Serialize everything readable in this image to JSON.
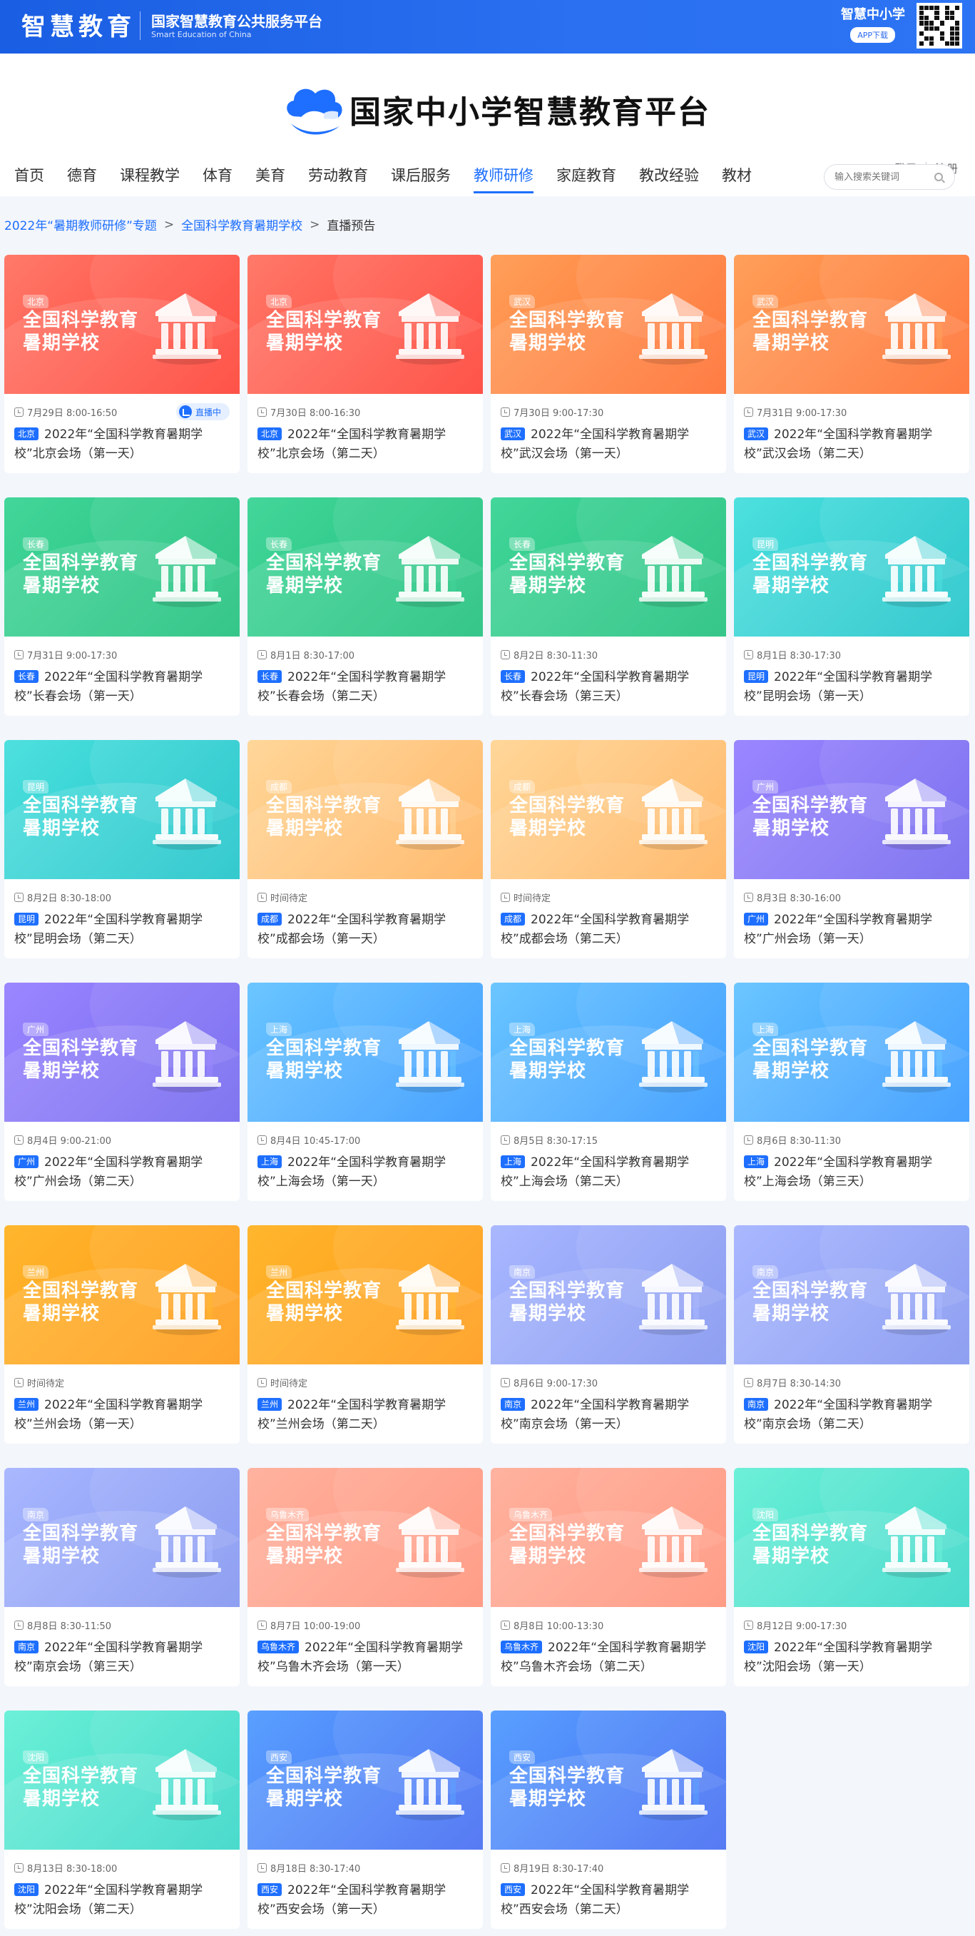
{
  "topbar": {
    "logo": "智慧教育",
    "platform": "国家智慧教育公共服务平台",
    "platform_en": "Smart Education of China",
    "app_title": "智慧中小学",
    "app_button": "APP下载"
  },
  "header": {
    "title": "国家中小学智慧教育平台",
    "login": "登录",
    "register": "注册"
  },
  "nav": [
    "首页",
    "德育",
    "课程教学",
    "体育",
    "美育",
    "劳动教育",
    "课后服务",
    "教师研修",
    "家庭教育",
    "教改经验",
    "教材"
  ],
  "nav_active": "教师研修",
  "search": {
    "placeholder": "输入搜索关键词"
  },
  "breadcrumb": {
    "items": [
      "2022年“暑期教师研修”专题",
      "全国科学教育暑期学校",
      "直播预告"
    ]
  },
  "thumb_title_line1": "全国科学教育",
  "thumb_title_line2": "暑期学校",
  "live_label": "直播中",
  "palettes": {
    "red": [
      "#ff7a6a",
      "#ff3b2f"
    ],
    "orange": [
      "#ffa05a",
      "#ff6a2a"
    ],
    "green": [
      "#44d69a",
      "#1abf7a"
    ],
    "teal": [
      "#4ee0de",
      "#19c2c8"
    ],
    "peach": [
      "#ffd79a",
      "#ffb15a"
    ],
    "purple": [
      "#9b87ff",
      "#6f63ee"
    ],
    "blue": [
      "#6cc6ff",
      "#2e95ff"
    ],
    "amber": [
      "#ffb62e",
      "#ff9812"
    ],
    "periwinkle": [
      "#aab8ff",
      "#7f92f0"
    ],
    "salmon": [
      "#ffb3a0",
      "#ff8f76"
    ],
    "mint": [
      "#6ef0d8",
      "#31d6c6"
    ],
    "royal": [
      "#5aa0ff",
      "#3f68f2"
    ]
  },
  "cards": [
    {
      "city": "北京",
      "time": "7月29日 8:00-16:50",
      "live": true,
      "title": "2022年“全国科学教育暑期学校”北京会场（第一天）",
      "palette": "red"
    },
    {
      "city": "北京",
      "time": "7月30日 8:00-16:30",
      "live": false,
      "title": "2022年“全国科学教育暑期学校”北京会场（第二天）",
      "palette": "red"
    },
    {
      "city": "武汉",
      "time": "7月30日 9:00-17:30",
      "live": false,
      "title": "2022年“全国科学教育暑期学校”武汉会场（第一天）",
      "palette": "orange"
    },
    {
      "city": "武汉",
      "time": "7月31日 9:00-17:30",
      "live": false,
      "title": "2022年“全国科学教育暑期学校”武汉会场（第二天）",
      "palette": "orange"
    },
    {
      "city": "长春",
      "time": "7月31日 9:00-17:30",
      "live": false,
      "title": "2022年“全国科学教育暑期学校”长春会场（第一天）",
      "palette": "green"
    },
    {
      "city": "长春",
      "time": "8月1日 8:30-17:00",
      "live": false,
      "title": "2022年“全国科学教育暑期学校”长春会场（第二天）",
      "palette": "green"
    },
    {
      "city": "长春",
      "time": "8月2日 8:30-11:30",
      "live": false,
      "title": "2022年“全国科学教育暑期学校”长春会场（第三天）",
      "palette": "green"
    },
    {
      "city": "昆明",
      "time": "8月1日 8:30-17:30",
      "live": false,
      "title": "2022年“全国科学教育暑期学校”昆明会场（第一天）",
      "palette": "teal"
    },
    {
      "city": "昆明",
      "time": "8月2日 8:30-18:00",
      "live": false,
      "title": "2022年“全国科学教育暑期学校”昆明会场（第二天）",
      "palette": "teal"
    },
    {
      "city": "成都",
      "time": "时间待定",
      "live": false,
      "title": "2022年“全国科学教育暑期学校”成都会场（第一天）",
      "palette": "peach"
    },
    {
      "city": "成都",
      "time": "时间待定",
      "live": false,
      "title": "2022年“全国科学教育暑期学校”成都会场（第二天）",
      "palette": "peach"
    },
    {
      "city": "广州",
      "time": "8月3日 8:30-16:00",
      "live": false,
      "title": "2022年“全国科学教育暑期学校”广州会场（第一天）",
      "palette": "purple"
    },
    {
      "city": "广州",
      "time": "8月4日 9:00-21:00",
      "live": false,
      "title": "2022年“全国科学教育暑期学校”广州会场（第二天）",
      "palette": "purple"
    },
    {
      "city": "上海",
      "time": "8月4日 10:45-17:00",
      "live": false,
      "title": "2022年“全国科学教育暑期学校”上海会场（第一天）",
      "palette": "blue"
    },
    {
      "city": "上海",
      "time": "8月5日 8:30-17:15",
      "live": false,
      "title": "2022年“全国科学教育暑期学校”上海会场（第二天）",
      "palette": "blue"
    },
    {
      "city": "上海",
      "time": "8月6日 8:30-11:30",
      "live": false,
      "title": "2022年“全国科学教育暑期学校”上海会场（第三天）",
      "palette": "blue"
    },
    {
      "city": "兰州",
      "time": "时间待定",
      "live": false,
      "title": "2022年“全国科学教育暑期学校”兰州会场（第一天）",
      "palette": "amber"
    },
    {
      "city": "兰州",
      "time": "时间待定",
      "live": false,
      "title": "2022年“全国科学教育暑期学校”兰州会场（第二天）",
      "palette": "amber"
    },
    {
      "city": "南京",
      "time": "8月6日 9:00-17:30",
      "live": false,
      "title": "2022年“全国科学教育暑期学校”南京会场（第一天）",
      "palette": "periwinkle"
    },
    {
      "city": "南京",
      "time": "8月7日 8:30-14:30",
      "live": false,
      "title": "2022年“全国科学教育暑期学校”南京会场（第二天）",
      "palette": "periwinkle"
    },
    {
      "city": "南京",
      "time": "8月8日 8:30-11:50",
      "live": false,
      "title": "2022年“全国科学教育暑期学校”南京会场（第三天）",
      "palette": "periwinkle"
    },
    {
      "city": "乌鲁木齐",
      "time": "8月7日 10:00-19:00",
      "live": false,
      "title": "2022年“全国科学教育暑期学校”乌鲁木齐会场（第一天）",
      "palette": "salmon"
    },
    {
      "city": "乌鲁木齐",
      "time": "8月8日 10:00-13:30",
      "live": false,
      "title": "2022年“全国科学教育暑期学校”乌鲁木齐会场（第二天）",
      "palette": "salmon"
    },
    {
      "city": "沈阳",
      "time": "8月12日 9:00-17:30",
      "live": false,
      "title": "2022年“全国科学教育暑期学校”沈阳会场（第一天）",
      "palette": "mint"
    },
    {
      "city": "沈阳",
      "time": "8月13日 8:30-18:00",
      "live": false,
      "title": "2022年“全国科学教育暑期学校”沈阳会场（第二天）",
      "palette": "mint"
    },
    {
      "city": "西安",
      "time": "8月18日 8:30-17:40",
      "live": false,
      "title": "2022年“全国科学教育暑期学校”西安会场（第一天）",
      "palette": "royal"
    },
    {
      "city": "西安",
      "time": "8月19日 8:30-17:40",
      "live": false,
      "title": "2022年“全国科学教育暑期学校”西安会场（第二天）",
      "palette": "royal"
    }
  ]
}
